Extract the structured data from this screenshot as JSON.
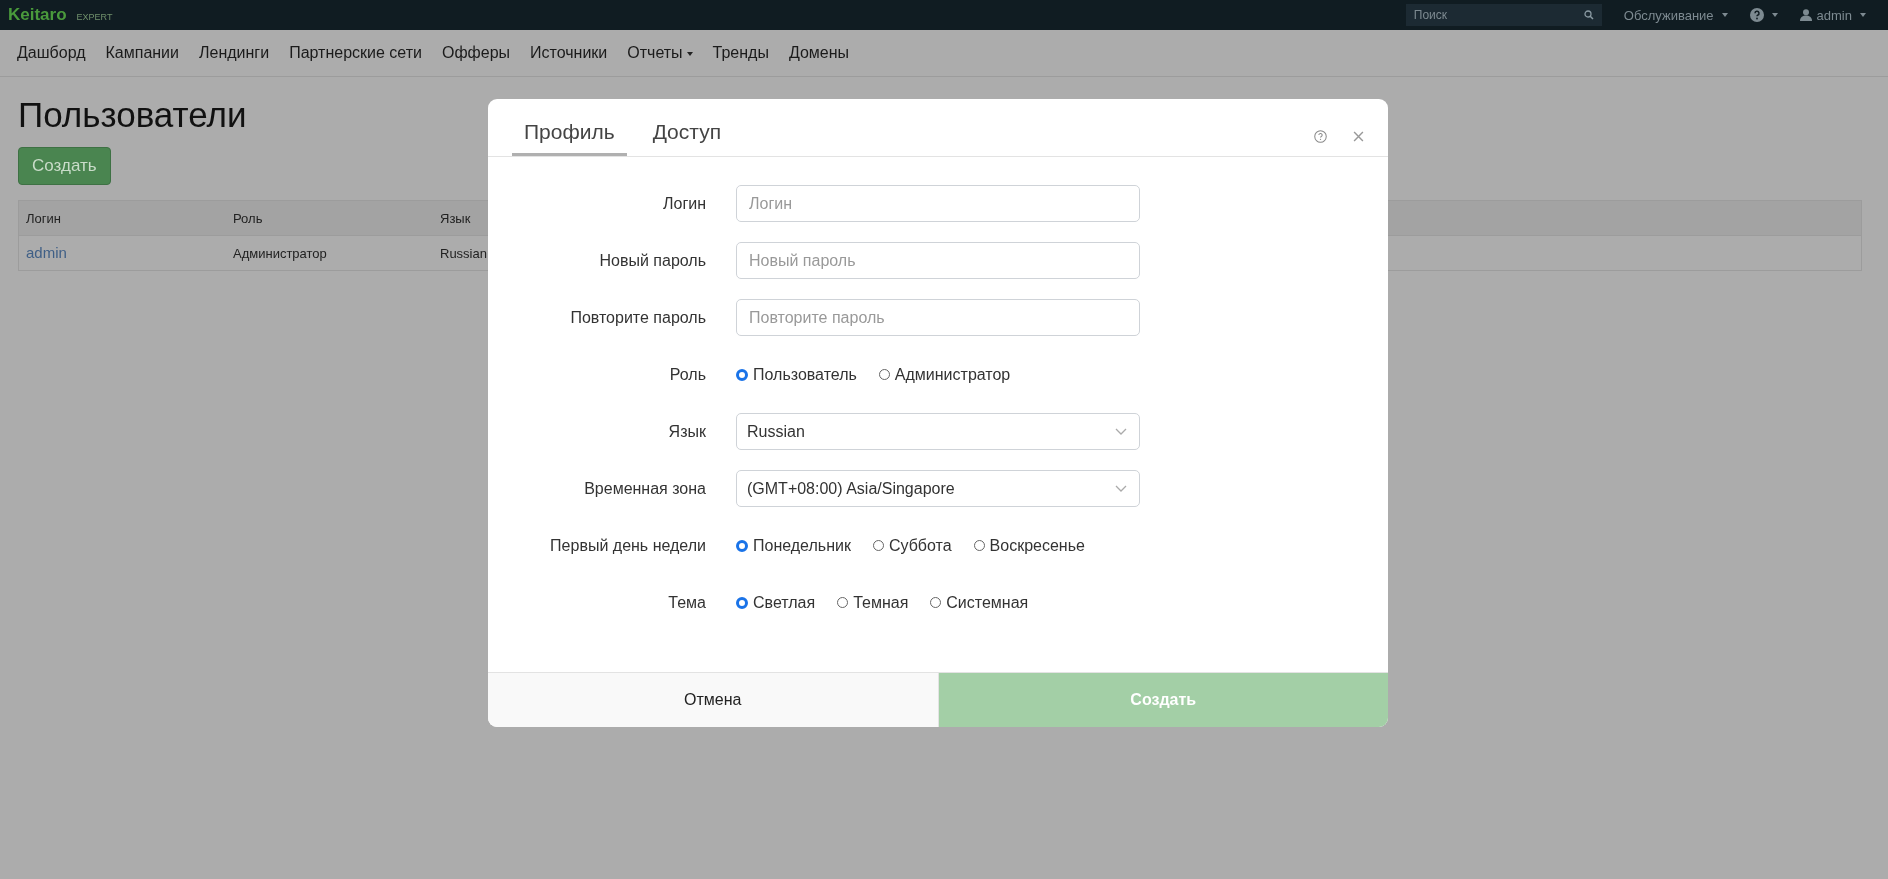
{
  "topbar": {
    "logo": "Keitaro",
    "edition": "EXPERT",
    "search": {
      "placeholder": "Поиск"
    },
    "service_menu": "Обслуживание",
    "user": "admin"
  },
  "nav": [
    {
      "label": "Дашборд",
      "dropdown": false
    },
    {
      "label": "Кампании",
      "dropdown": false
    },
    {
      "label": "Лендинги",
      "dropdown": false
    },
    {
      "label": "Партнерские сети",
      "dropdown": false
    },
    {
      "label": "Офферы",
      "dropdown": false
    },
    {
      "label": "Источники",
      "dropdown": false
    },
    {
      "label": "Отчеты",
      "dropdown": true
    },
    {
      "label": "Тренды",
      "dropdown": false
    },
    {
      "label": "Домены",
      "dropdown": false
    }
  ],
  "page": {
    "title": "Пользователи",
    "create_button": "Создать",
    "table": {
      "columns": [
        "Логин",
        "Роль",
        "Язык"
      ],
      "rows": [
        [
          "admin",
          "Администратор",
          "Russian"
        ]
      ]
    }
  },
  "modal": {
    "tabs": [
      {
        "label": "Профиль",
        "selected": true
      },
      {
        "label": "Доступ",
        "selected": false
      }
    ],
    "fields": [
      {
        "kind": "input",
        "label": "Логин",
        "placeholder": "Логин"
      },
      {
        "kind": "input",
        "label": "Новый пароль",
        "placeholder": "Новый пароль"
      },
      {
        "kind": "input",
        "label": "Повторите пароль",
        "placeholder": "Повторите пароль"
      },
      {
        "kind": "radio",
        "label": "Роль",
        "options": [
          {
            "label": "Пользователь",
            "selected": true
          },
          {
            "label": "Администратор",
            "selected": false
          }
        ]
      },
      {
        "kind": "select",
        "label": "Язык",
        "value": "Russian"
      },
      {
        "kind": "select",
        "label": "Временная зона",
        "value": "(GMT+08:00) Asia/Singapore"
      },
      {
        "kind": "radio",
        "label": "Первый день недели",
        "options": [
          {
            "label": "Понедельник",
            "selected": true
          },
          {
            "label": "Суббота",
            "selected": false
          },
          {
            "label": "Воскресенье",
            "selected": false
          }
        ]
      },
      {
        "kind": "radio",
        "label": "Тема",
        "options": [
          {
            "label": "Светлая",
            "selected": true
          },
          {
            "label": "Темная",
            "selected": false
          },
          {
            "label": "Системная",
            "selected": false
          }
        ]
      }
    ],
    "cancel_button": "Отмена",
    "submit_button": "Создать"
  }
}
